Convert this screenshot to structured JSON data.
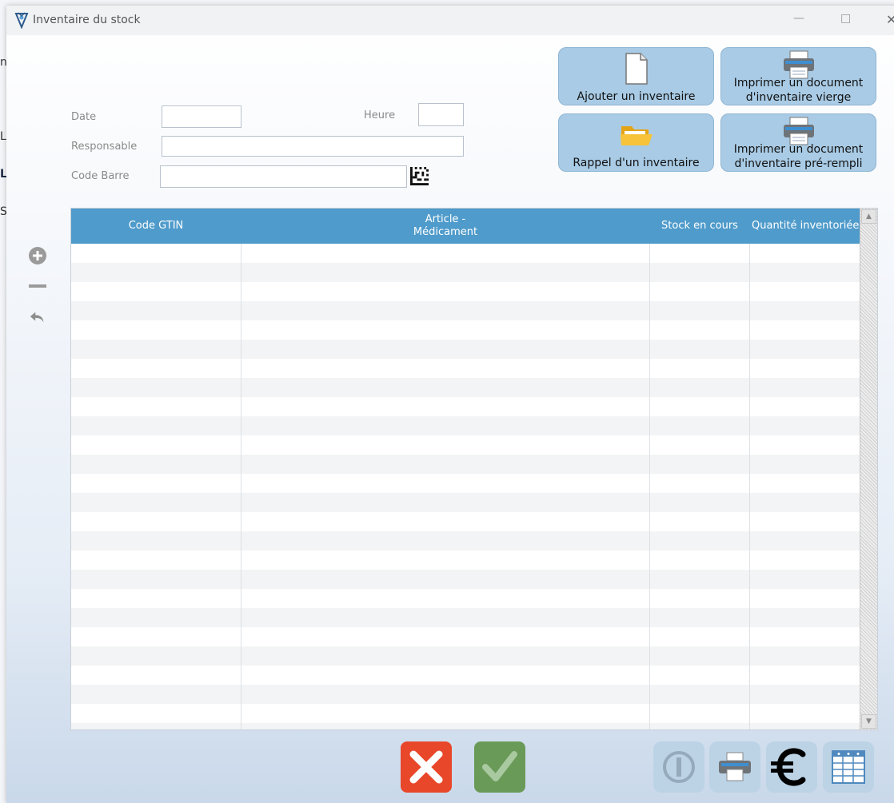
{
  "window": {
    "title": "Inventaire du stock"
  },
  "background_edge": {
    "letters": [
      "n",
      "L",
      "L",
      "S"
    ]
  },
  "form": {
    "date_label": "Date",
    "date_value": "",
    "heure_label": "Heure",
    "heure_value": "",
    "responsable_label": "Responsable",
    "responsable_value": "",
    "code_barre_label": "Code Barre",
    "code_barre_value": ""
  },
  "actions": {
    "add_inventory": "Ajouter un inventaire",
    "print_blank_line1": "Imprimer un document",
    "print_blank_line2": "d'inventaire vierge",
    "recall_inventory": "Rappel d'un inventaire",
    "print_filled_line1": "Imprimer un document",
    "print_filled_line2": "d'inventaire pré-rempli"
  },
  "table": {
    "columns": [
      {
        "label": "Code GTIN"
      },
      {
        "label": "Article -\nMédicament"
      },
      {
        "label": "Stock en cours"
      },
      {
        "label": "Quantité inventoriée"
      }
    ],
    "rows": []
  },
  "icons": {
    "side": [
      "add-circle-icon",
      "minus-icon",
      "undo-arrow-icon"
    ],
    "bottom": [
      "close-x-icon",
      "checkmark-icon",
      "power-icon",
      "printer-icon",
      "euro-icon",
      "table-icon"
    ]
  },
  "colors": {
    "header": "#4f9bcb",
    "action_button": "#a9cbe5",
    "cancel": "#e8472a",
    "confirm": "#6a9a58",
    "disabled_button": "#bcd3e6"
  }
}
